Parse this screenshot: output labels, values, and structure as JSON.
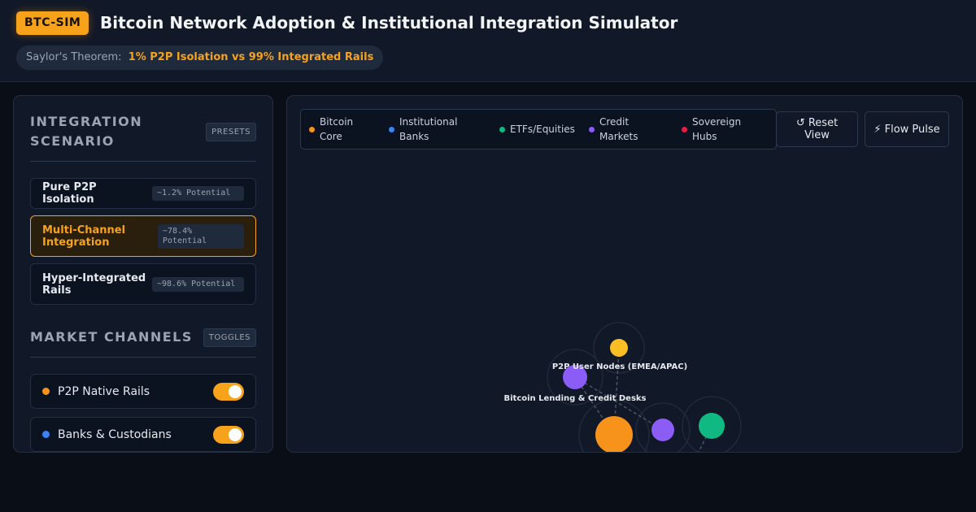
{
  "header": {
    "brand": "BTC-SIM",
    "title": "Bitcoin Network Adoption & Institutional Integration Simulator",
    "theorem_label": "Saylor's Theorem:",
    "theorem_value": "1% P2P Isolation vs 99% Integrated Rails"
  },
  "scenario": {
    "title": "INTEGRATION SCENARIO",
    "tag": "PRESETS",
    "presets": [
      {
        "name": "Pure P2P Isolation",
        "potential": "~1.2% Potential",
        "active": false
      },
      {
        "name": "Multi-Channel Integration",
        "potential": "~78.4% Potential",
        "active": true
      },
      {
        "name": "Hyper-Integrated Rails",
        "potential": "~98.6% Potential",
        "active": false
      }
    ]
  },
  "channels": {
    "title": "MARKET CHANNELS",
    "tag": "TOGGLES",
    "items": [
      {
        "label": "P2P Native Rails",
        "color": "#f7931a",
        "enabled": true
      },
      {
        "label": "Banks & Custodians",
        "color": "#3b82f6",
        "enabled": true
      }
    ]
  },
  "legend": [
    {
      "label": "Bitcoin Core",
      "color": "#f7931a"
    },
    {
      "label": "Institutional Banks",
      "color": "#3b82f6"
    },
    {
      "label": "ETFs/Equities",
      "color": "#10b981"
    },
    {
      "label": "Credit Markets",
      "color": "#8b5cf6"
    },
    {
      "label": "Sovereign Hubs",
      "color": "#e11d48"
    }
  ],
  "buttons": {
    "reset": "↺ Reset View",
    "pulse": "⚡ Flow Pulse"
  },
  "graph": {
    "labels": {
      "p2p_nodes": "P2P User Nodes (EMEA/APAC)",
      "lending": "Bitcoin Lending & Credit Desks"
    },
    "colors": {
      "core": "#f7931a",
      "p2p": "#fbbf24",
      "credit": "#8b5cf6",
      "etf": "#10b981"
    }
  }
}
